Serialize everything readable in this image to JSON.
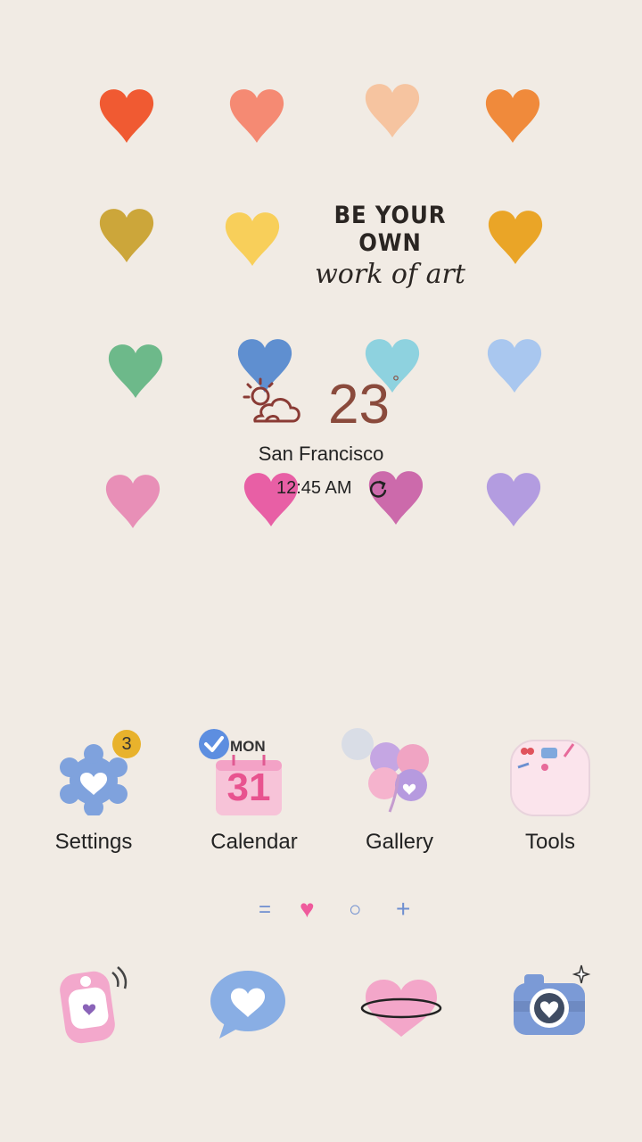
{
  "wallpaper": {
    "quote_line1": "BE YOUR OWN",
    "quote_line2": "work of art",
    "heart_colors": [
      "#f05a32",
      "#f58a73",
      "#f6c4a0",
      "#f08a3b",
      "#cca63a",
      "#f8cf5a",
      "#eaa527",
      "#6db98a",
      "#5f8fd0",
      "#8ed2df",
      "#a9c7ef",
      "#e88fb7",
      "#e85fa5",
      "#cc6aab",
      "#b39ce0"
    ]
  },
  "weather": {
    "icon": "partly-cloudy-icon",
    "temperature": "23",
    "degree_symbol": "°",
    "city": "San Francisco",
    "time": "12:45 AM"
  },
  "apps": [
    {
      "label": "Settings",
      "icon": "gear-heart-icon",
      "badge": "3"
    },
    {
      "label": "Calendar",
      "icon": "calendar-icon",
      "day": "MON",
      "date": "31"
    },
    {
      "label": "Gallery",
      "icon": "clover-icon"
    },
    {
      "label": "Tools",
      "icon": "tools-folder-icon"
    }
  ],
  "pager": {
    "menu": "=",
    "current": "♥",
    "page": "○",
    "add": "+"
  },
  "dock": [
    {
      "icon": "phone-icon"
    },
    {
      "icon": "message-icon"
    },
    {
      "icon": "internet-heart-icon"
    },
    {
      "icon": "camera-icon"
    }
  ],
  "colors": {
    "background": "#f1ebe4",
    "accent_blue": "#6f8fd0",
    "temp": "#8a4a3c",
    "pink": "#f3a2c6"
  }
}
